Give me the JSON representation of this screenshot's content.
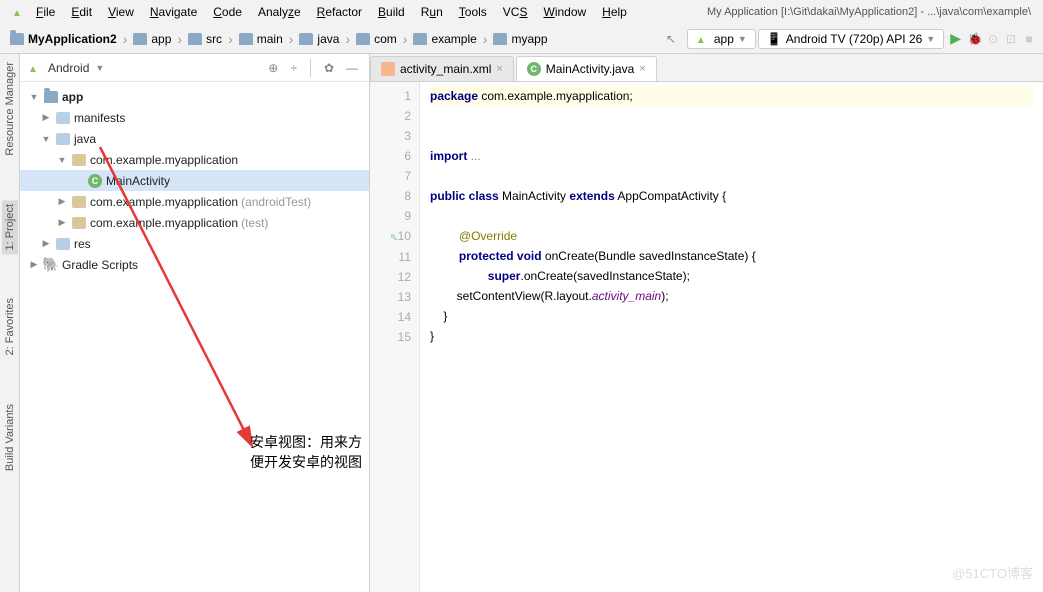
{
  "window_title": "My Application [I:\\Git\\dakai\\MyApplication2] - ...\\java\\com\\example\\",
  "menu": [
    "File",
    "Edit",
    "View",
    "Navigate",
    "Code",
    "Analyze",
    "Refactor",
    "Build",
    "Run",
    "Tools",
    "VCS",
    "Window",
    "Help"
  ],
  "breadcrumbs": [
    "MyApplication2",
    "app",
    "src",
    "main",
    "java",
    "com",
    "example",
    "myapp"
  ],
  "run_config": "app",
  "device": "Android TV (720p) API 26",
  "sidebar": {
    "view": "Android",
    "tree": {
      "app": "app",
      "manifests": "manifests",
      "java": "java",
      "pkg1": "com.example.myapplication",
      "cls": "MainActivity",
      "pkg2": "com.example.myapplication",
      "pkg2_suffix": " (androidTest)",
      "pkg3": "com.example.myapplication",
      "pkg3_suffix": " (test)",
      "res": "res",
      "gradle": "Gradle Scripts"
    }
  },
  "leftrail": {
    "rm": "Resource Manager",
    "proj": "1: Project",
    "fav": "2: Favorites",
    "bv": "Build Variants"
  },
  "tabs": {
    "tab1": "activity_main.xml",
    "tab2": "MainActivity.java"
  },
  "gutter": [
    "1",
    "2",
    "3",
    "6",
    "7",
    "8",
    "9",
    "10",
    "11",
    "12",
    "13",
    "14",
    "15"
  ],
  "code": {
    "l1a": "package",
    "l1b": " com.example.myapplication;",
    "l3a": "import",
    "l3b": " ...",
    "l7a": "public class",
    "l7b": " MainActivity ",
    "l7c": "extends",
    "l7d": " AppCompatActivity {",
    "l9": "@Override",
    "l10a": "protected void",
    "l10b": " onCreate(Bundle savedInstanceState) {",
    "l11a": "super",
    "l11b": ".onCreate(savedInstanceState);",
    "l12a": "        setContentView(R.layout.",
    "l12b": "activity_main",
    "l12c": ");",
    "l13": "    }",
    "l14": "}"
  },
  "annotation": "安卓视图：用来方便开发安卓的视图",
  "watermark": "@51CTO博客"
}
